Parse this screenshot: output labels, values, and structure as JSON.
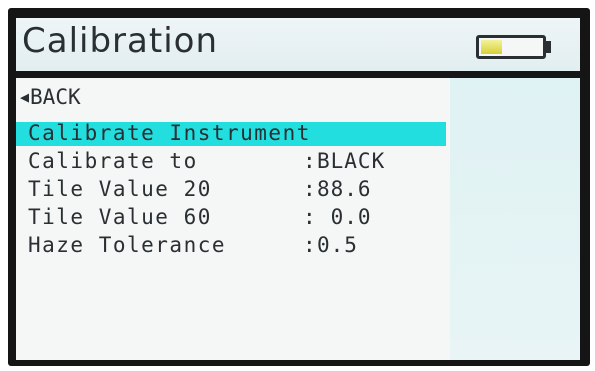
{
  "header": {
    "title": "Calibration",
    "battery": {
      "level": 0.35,
      "icon": "battery-icon",
      "fill_color": "#e6e04a"
    }
  },
  "nav": {
    "back_icon": "left-triangle-icon",
    "back_label": "BACK"
  },
  "menu": {
    "selected_index": 0,
    "highlight_color": "#22dede",
    "items": [
      {
        "label": "Calibrate Instrument",
        "separator": "",
        "value": ""
      },
      {
        "label": "Calibrate to",
        "separator": ":",
        "value": "BLACK"
      },
      {
        "label": "Tile Value 20",
        "separator": ":",
        "value": "88.6"
      },
      {
        "label": "Tile Value 60",
        "separator": ":",
        "value": " 0.0"
      },
      {
        "label": "Haze Tolerance",
        "separator": ":",
        "value": "0.5"
      }
    ]
  }
}
